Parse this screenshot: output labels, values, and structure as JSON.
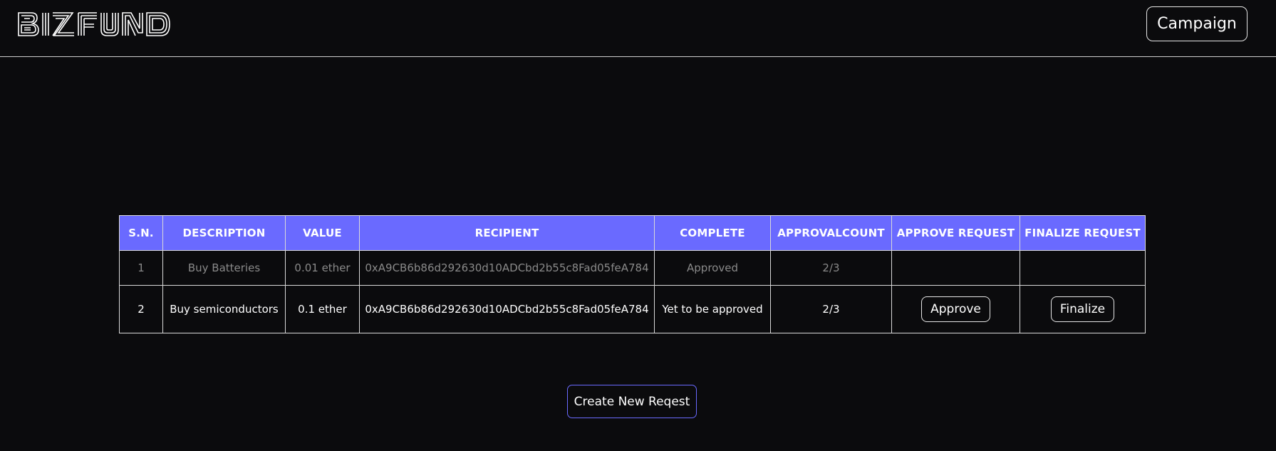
{
  "navbar": {
    "logo_text": "BIZFUND",
    "campaign_label": "Campaign"
  },
  "table": {
    "headers": [
      "S.N.",
      "DESCRIPTION",
      "VALUE",
      "RECIPIENT",
      "COMPLETE",
      "APPROVALCOUNT",
      "APPROVE REQUEST",
      "FINALIZE REQUEST"
    ],
    "rows": [
      {
        "sn": "1",
        "description": "Buy Batteries",
        "value": "0.01 ether",
        "recipient": "0xA9CB6b86d292630d10ADCbd2b55c8Fad05feA784",
        "complete": "Approved",
        "approval_count": "2/3",
        "approve_label": "",
        "finalize_label": ""
      },
      {
        "sn": "2",
        "description": "Buy semiconductors",
        "value": "0.1 ether",
        "recipient": "0xA9CB6b86d292630d10ADCbd2b55c8Fad05feA784",
        "complete": "Yet to be approved",
        "approval_count": "2/3",
        "approve_label": "Approve",
        "finalize_label": "Finalize"
      }
    ]
  },
  "create_button_label": "Create New Reqest",
  "colors": {
    "background": "#0b0b0d",
    "header_bg": "#6a6aff",
    "accent_border": "#6a6aff",
    "muted_text": "#8a8a8a"
  }
}
